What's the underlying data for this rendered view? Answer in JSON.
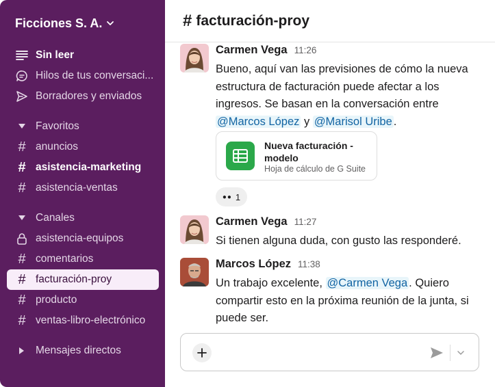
{
  "workspace": {
    "name": "Ficciones S. A."
  },
  "sidebar": {
    "top_items": [
      {
        "label": "Sin leer",
        "icon": "unread-icon"
      },
      {
        "label": "Hilos de tus conversaci...",
        "icon": "threads-icon"
      },
      {
        "label": "Borradores y enviados",
        "icon": "send-icon"
      }
    ],
    "favorites": {
      "label": "Favoritos",
      "channels": [
        "anuncios",
        "asistencia-marketing",
        "asistencia-ventas"
      ]
    },
    "channels": {
      "label": "Canales",
      "items": [
        "asistencia-equipos",
        "comentarios",
        "facturación-proy",
        "producto",
        "ventas-libro-electrónico"
      ]
    },
    "direct_messages": {
      "label": "Mensajes directos"
    }
  },
  "channel": {
    "hash": "#",
    "name": "facturación-proy"
  },
  "messages": [
    {
      "author": "Carmen Vega",
      "time": "11:26",
      "text_1": "Bueno, aquí van las previsiones de cómo la nueva estructura de facturación puede afectar a los ingresos. Se basan en la conversación entre ",
      "mention_1": "@Marcos López",
      "text_2": " y ",
      "mention_2": "@Marisol Uribe",
      "text_3": ".",
      "attachment": {
        "title": "Nueva facturación - modelo",
        "subtitle": "Hoja de cálculo de G Suite",
        "icon": "spreadsheet-icon"
      },
      "reaction": {
        "emoji": "👀",
        "count": "1"
      }
    },
    {
      "author": "Carmen Vega",
      "time": "11:27",
      "text": "Si tienen alguna duda, con gusto las responderé."
    },
    {
      "author": "Marcos López",
      "time": "11:38",
      "text_1": "Un trabajo excelente, ",
      "mention": "@Carmen Vega",
      "text_2": ". Quiero compartir esto en la próxima reunión de la junta, si puede ser."
    }
  ],
  "composer": {
    "placeholder": ""
  },
  "colors": {
    "sidebar": "#5b1e5f",
    "active_item": "#f8edf9",
    "mention": "#1264a3",
    "sheet": "#2ba84a"
  }
}
